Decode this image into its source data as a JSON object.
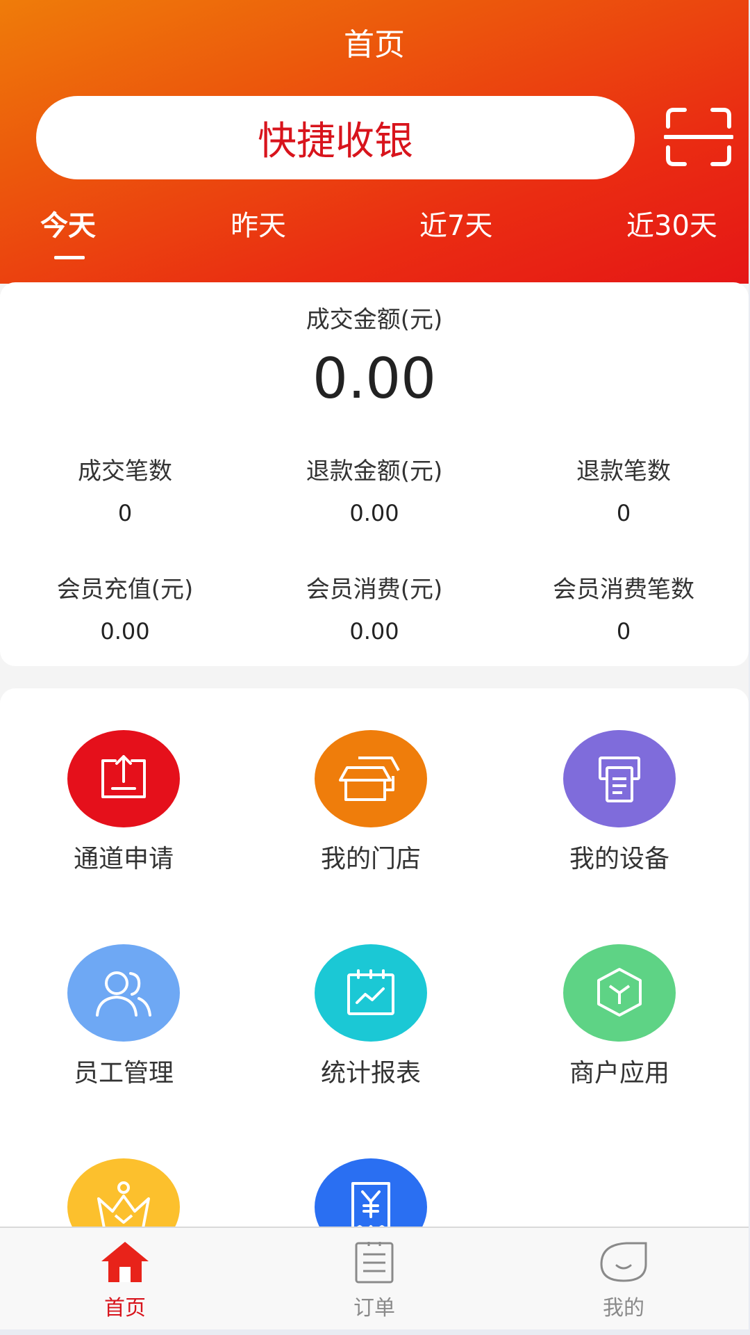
{
  "header": {
    "title": "首页",
    "quick_pay_label": "快捷收银"
  },
  "tabs": [
    "今天",
    "昨天",
    "近7天",
    "近30天"
  ],
  "stats": {
    "main_label": "成交金额(元)",
    "main_value": "0.00",
    "items": [
      {
        "label": "成交笔数",
        "value": "0"
      },
      {
        "label": "退款金额(元)",
        "value": "0.00"
      },
      {
        "label": "退款笔数",
        "value": "0"
      },
      {
        "label": "会员充值(元)",
        "value": "0.00"
      },
      {
        "label": "会员消费(元)",
        "value": "0.00"
      },
      {
        "label": "会员消费笔数",
        "value": "0"
      }
    ]
  },
  "menu": [
    {
      "label": "通道申请",
      "icon": "upload-icon",
      "color": "#e5101b"
    },
    {
      "label": "我的门店",
      "icon": "store-icon",
      "color": "#ef7d0b"
    },
    {
      "label": "我的设备",
      "icon": "device-icon",
      "color": "#7f6cdb"
    },
    {
      "label": "员工管理",
      "icon": "staff-icon",
      "color": "#6ea8f4"
    },
    {
      "label": "统计报表",
      "icon": "report-icon",
      "color": "#1bc8d5"
    },
    {
      "label": "商户应用",
      "icon": "cube-icon",
      "color": "#5ed385"
    },
    {
      "label": "",
      "icon": "crown-icon",
      "color": "#fcc02d"
    },
    {
      "label": "",
      "icon": "receipt-yuan-icon",
      "color": "#2a6ff2"
    }
  ],
  "nav": [
    {
      "label": "首页",
      "icon": "home-icon"
    },
    {
      "label": "订单",
      "icon": "order-icon"
    },
    {
      "label": "我的",
      "icon": "profile-icon"
    }
  ],
  "colors": {
    "brand_red": "#d8141c",
    "header_start": "#ef7c0a",
    "header_end": "#e51616"
  }
}
